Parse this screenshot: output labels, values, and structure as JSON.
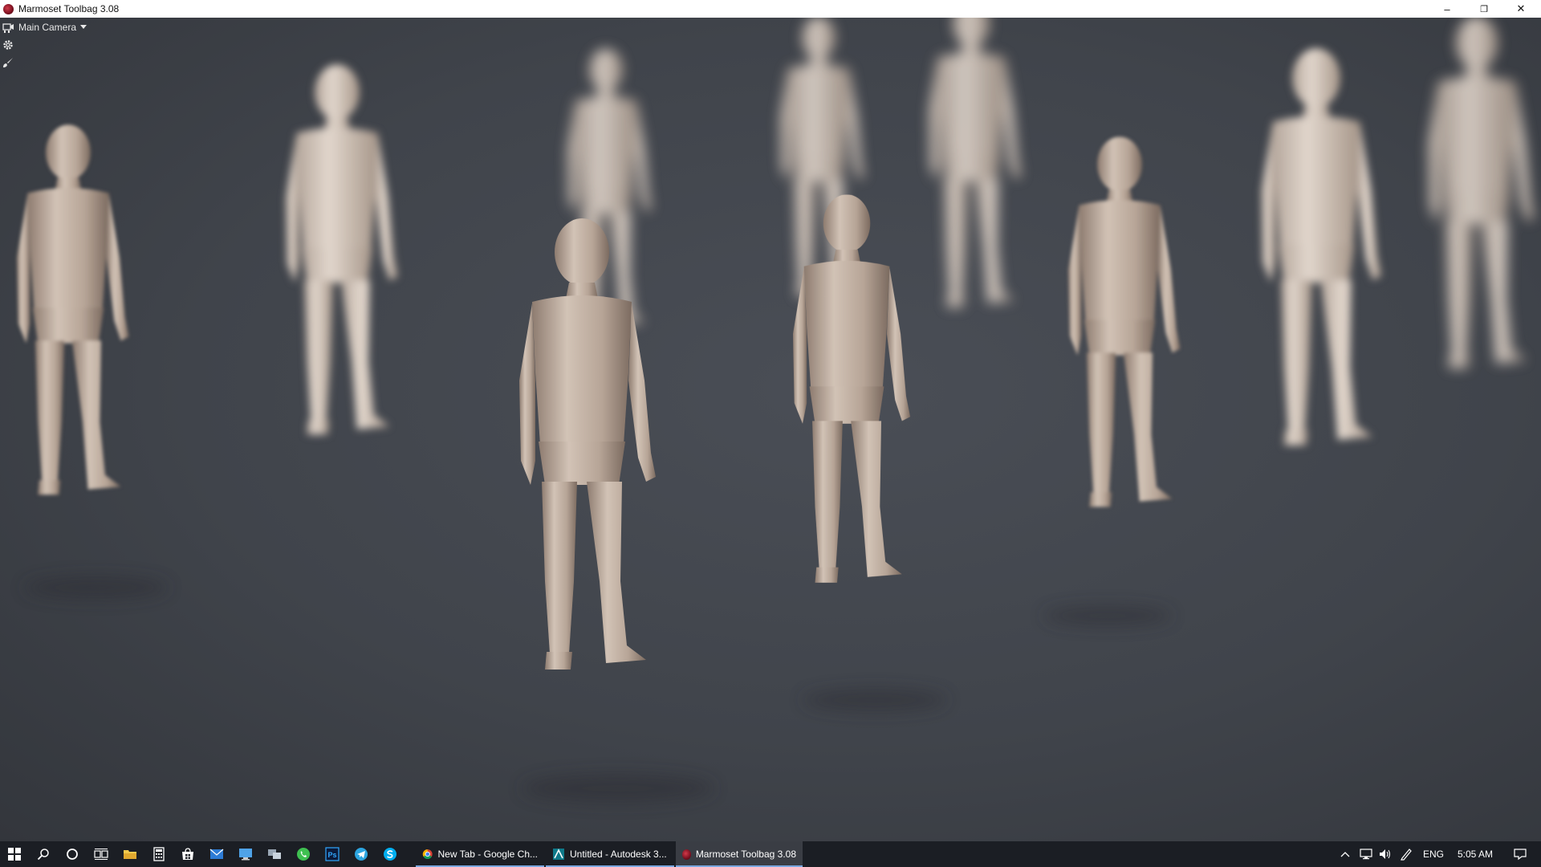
{
  "window": {
    "title": "Marmoset Toolbag 3.08",
    "controls": {
      "minimize": "–",
      "maximize": "❐",
      "close": "✕"
    }
  },
  "viewport": {
    "camera_label": "Main Camera",
    "camera_dropdown_icon": "caret-down-icon",
    "settings_icon": "gear-icon",
    "edit_icon": "brush-icon",
    "background_color": "#40444b"
  },
  "scene": {
    "description_icon": "low-poly-figures",
    "figure_color": "#b8a89a"
  },
  "taskbar": {
    "pinned_icons": [
      "windows-start-icon",
      "search-icon",
      "cortana-icon",
      "task-view-icon",
      "file-explorer-icon",
      "calculator-icon",
      "store-icon",
      "mail-icon",
      "desktop-icon",
      "network-icon",
      "whatsapp-icon",
      "photoshop-icon",
      "telegram-icon",
      "skype-icon"
    ],
    "photoshop_label": "Ps",
    "tasks": [
      {
        "label": "New Tab - Google Ch...",
        "icon": "chrome-icon"
      },
      {
        "label": "Untitled - Autodesk 3...",
        "icon": "3dsmax-icon"
      },
      {
        "label": "Marmoset Toolbag 3.08",
        "icon": "marmoset-icon"
      }
    ],
    "tray": {
      "language": "ENG",
      "time": "5:05 AM"
    }
  }
}
